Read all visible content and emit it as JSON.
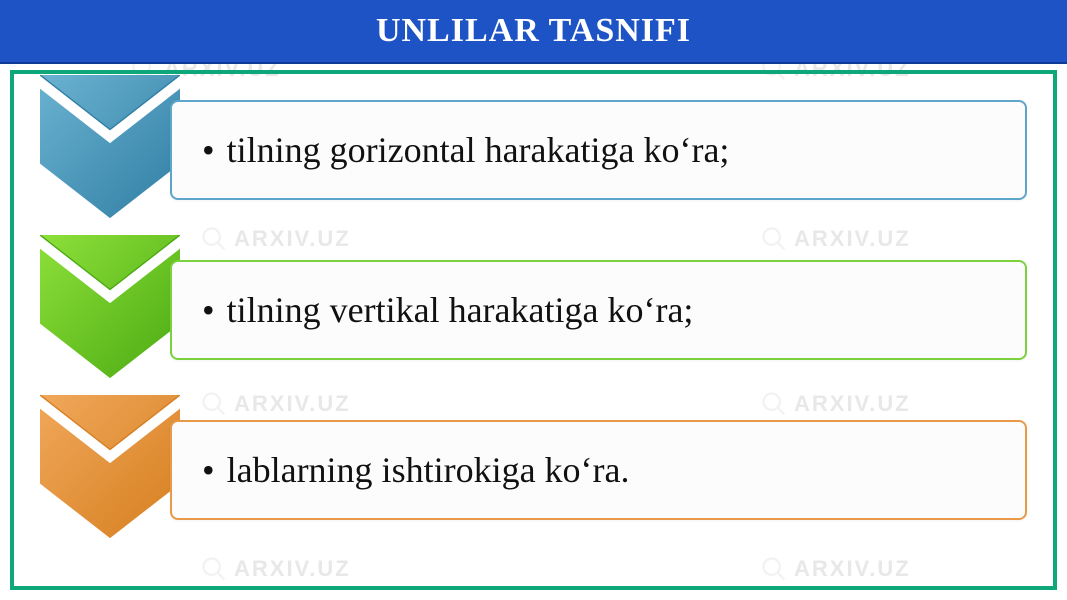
{
  "header": {
    "title": "UNLILAR TASNIFI"
  },
  "items": [
    {
      "text": "tilning gorizontal harakatiga ko‘ra;",
      "color_light": "#6bb2d1",
      "color_dark": "#2f7ea3",
      "border": "#5ea6c9",
      "card_class": "card-blue"
    },
    {
      "text": "tilning vertikal harakatiga ko‘ra;",
      "color_light": "#8ee03a",
      "color_dark": "#4aaa12",
      "border": "#7bd13e",
      "card_class": "card-green"
    },
    {
      "text": "lablarning ishtirokiga ko‘ra.",
      "color_light": "#f0a85a",
      "color_dark": "#d67e1f",
      "border": "#e89a4a",
      "card_class": "card-orange"
    }
  ],
  "watermark_text": "ARXIV.UZ"
}
